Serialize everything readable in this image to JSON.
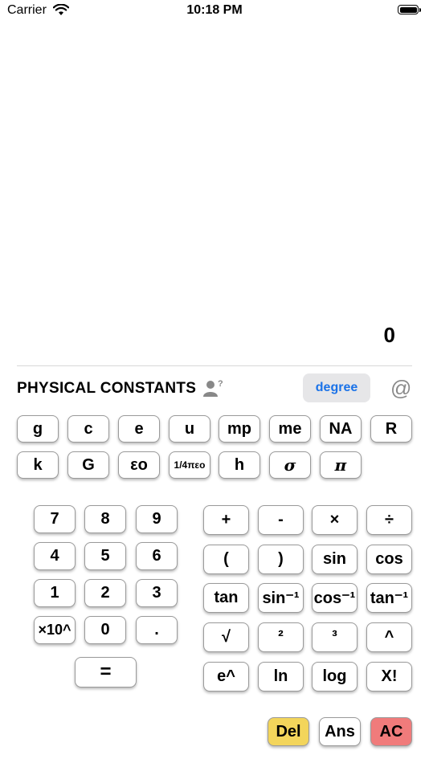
{
  "status_bar": {
    "carrier": "Carrier",
    "time": "10:18 PM"
  },
  "display": {
    "value": "0"
  },
  "constants": {
    "title": "PHYSICAL CONSTANTS",
    "help_icon": "person-question-icon",
    "mode_label": "degree",
    "at_label": "@",
    "row1": [
      "g",
      "c",
      "e",
      "u",
      "mp",
      "me",
      "NA",
      "R"
    ],
    "row2": [
      "k",
      "G",
      "εo",
      "1/4πεo",
      "h",
      "σ",
      "π"
    ]
  },
  "numpad": {
    "keys": [
      "7",
      "8",
      "9",
      "4",
      "5",
      "6",
      "1",
      "2",
      "3",
      "×10^",
      "0",
      "."
    ],
    "equals": "="
  },
  "functions": {
    "keys": [
      "+",
      "-",
      "×",
      "÷",
      "(",
      ")",
      "sin",
      "cos",
      "tan",
      "sin⁻¹",
      "cos⁻¹",
      "tan⁻¹",
      "√",
      "²",
      "³",
      "^",
      "e^",
      "ln",
      "log",
      "X!"
    ]
  },
  "actions": {
    "del": "Del",
    "ans": "Ans",
    "ac": "AC"
  },
  "colors": {
    "degree_text": "#1a72e8",
    "degree_bg": "#e6e6e8",
    "del_bg": "#f3d55b",
    "ac_bg": "#f07b7b",
    "at_color": "#8a8a8a"
  }
}
